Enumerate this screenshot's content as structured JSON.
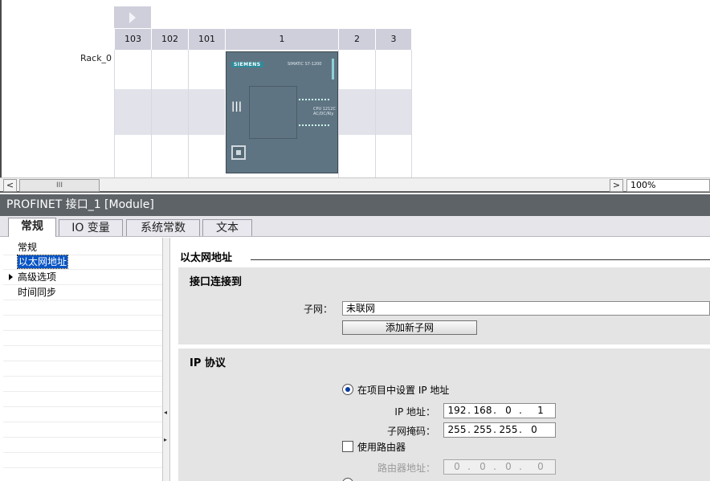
{
  "device_view": {
    "rack_label": "Rack_0",
    "slots": [
      "103",
      "102",
      "101",
      "1",
      "2",
      "3"
    ],
    "cpu": {
      "brand": "SIEMENS",
      "model": "SIMATIC S7-1200",
      "text_lines": [
        "CPU 1212C",
        "AC/DC/Rly"
      ]
    },
    "scroll_thumb": "III",
    "zoom": "100%"
  },
  "properties": {
    "title": "PROFINET 接口_1 [Module]",
    "tabs": [
      "常规",
      "IO 变量",
      "系统常数",
      "文本"
    ],
    "nav": [
      "常规",
      "以太网地址",
      "高级选项",
      "时间同步"
    ],
    "section_title": "以太网地址",
    "interface_group": {
      "title": "接口连接到",
      "subnet_label": "子网：",
      "subnet_value": "未联网",
      "add_subnet_button": "添加新子网"
    },
    "ip_group": {
      "title": "IP 协议",
      "radio_set_in_project": "在项目中设置 IP 地址",
      "ip_label": "IP 地址：",
      "ip": [
        "192",
        "168",
        "0",
        "1"
      ],
      "mask_label": "子网掩码：",
      "mask": [
        "255",
        "255",
        "255",
        "0"
      ],
      "use_router_label": "使用路由器",
      "router_label": "路由器地址：",
      "router": [
        "0",
        "0",
        "0",
        "0"
      ]
    }
  }
}
